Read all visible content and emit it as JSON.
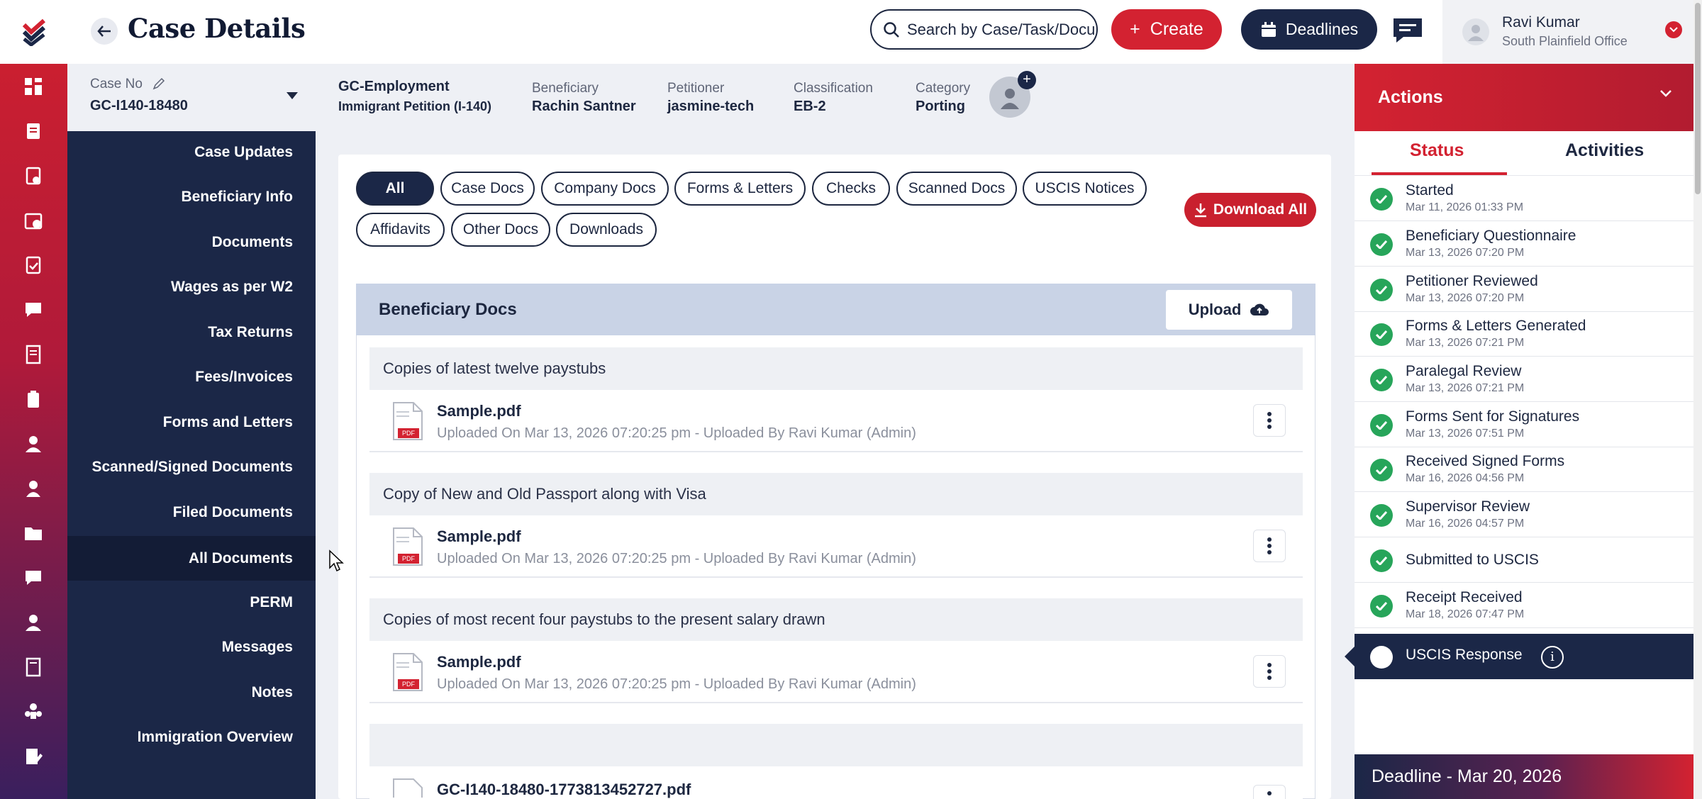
{
  "header": {
    "title": "Case Details",
    "search_placeholder": "Search by Case/Task/Docu",
    "create_label": "Create",
    "deadlines_label": "Deadlines",
    "user_name": "Ravi Kumar",
    "user_office": "South Plainfield Office"
  },
  "case": {
    "case_no_label": "Case No",
    "case_no": "GC-I140-18480",
    "type": "GC-Employment",
    "petition": "Immigrant Petition (I-140)",
    "beneficiary_label": "Beneficiary",
    "beneficiary": "Rachin Santner",
    "petitioner_label": "Petitioner",
    "petitioner": "jasmine-tech",
    "classification_label": "Classification",
    "classification": "EB-2",
    "category_label": "Category",
    "category": "Porting"
  },
  "sidenav": {
    "items": [
      "Case Updates",
      "Beneficiary Info",
      "Documents",
      "Wages as per W2",
      "Tax Returns",
      "Fees/Invoices",
      "Forms and Letters",
      "Scanned/Signed Documents",
      "Filed Documents",
      "All Documents",
      "PERM",
      "Messages",
      "Notes",
      "Immigration Overview"
    ],
    "active": "All Documents"
  },
  "filters": {
    "chips": [
      "All",
      "Case Docs",
      "Company Docs",
      "Forms & Letters",
      "Checks",
      "Scanned Docs",
      "USCIS Notices",
      "Affidavits",
      "Other Docs",
      "Downloads"
    ],
    "active": "All",
    "download_all": "Download All"
  },
  "docs": {
    "panel_title": "Beneficiary Docs",
    "upload_label": "Upload",
    "sections": [
      {
        "title": "Copies of latest twelve paystubs",
        "file": "Sample.pdf",
        "meta": "Uploaded On Mar 13, 2026 07:20:25 pm - Uploaded By Ravi Kumar (Admin)"
      },
      {
        "title": "Copy of New and Old Passport along with Visa",
        "file": "Sample.pdf",
        "meta": "Uploaded On Mar 13, 2026 07:20:25 pm - Uploaded By Ravi Kumar (Admin)"
      },
      {
        "title": "Copies of most recent four paystubs to the present salary drawn",
        "file": "Sample.pdf",
        "meta": "Uploaded On Mar 13, 2026 07:20:25 pm - Uploaded By Ravi Kumar (Admin)"
      },
      {
        "title": "",
        "file": "GC-I140-18480-1773813452727.pdf",
        "meta": ""
      }
    ],
    "pdf_tag": "PDF"
  },
  "actions": {
    "title": "Actions",
    "tabs": [
      "Status",
      "Activities"
    ],
    "statuses": [
      {
        "label": "Started",
        "date": "Mar 11, 2026 01:33 PM"
      },
      {
        "label": "Beneficiary Questionnaire",
        "date": "Mar 13, 2026 07:20 PM"
      },
      {
        "label": "Petitioner Reviewed",
        "date": "Mar 13, 2026 07:20 PM"
      },
      {
        "label": "Forms & Letters Generated",
        "date": "Mar 13, 2026 07:21 PM"
      },
      {
        "label": "Paralegal Review",
        "date": "Mar 13, 2026 07:21 PM"
      },
      {
        "label": "Forms Sent for Signatures",
        "date": "Mar 13, 2026 07:51 PM"
      },
      {
        "label": "Received Signed Forms",
        "date": "Mar 16, 2026 04:56 PM"
      },
      {
        "label": "Supervisor Review",
        "date": "Mar 16, 2026 04:57 PM"
      },
      {
        "label": "Submitted to USCIS",
        "date": ""
      },
      {
        "label": "Receipt Received",
        "date": "Mar 18, 2026 07:47 PM"
      }
    ],
    "pending": "USCIS Response",
    "deadline": "Deadline - Mar 20, 2026"
  },
  "colors": {
    "brand_red": "#d32231",
    "navy": "#1b2747",
    "success": "#27a55a"
  }
}
